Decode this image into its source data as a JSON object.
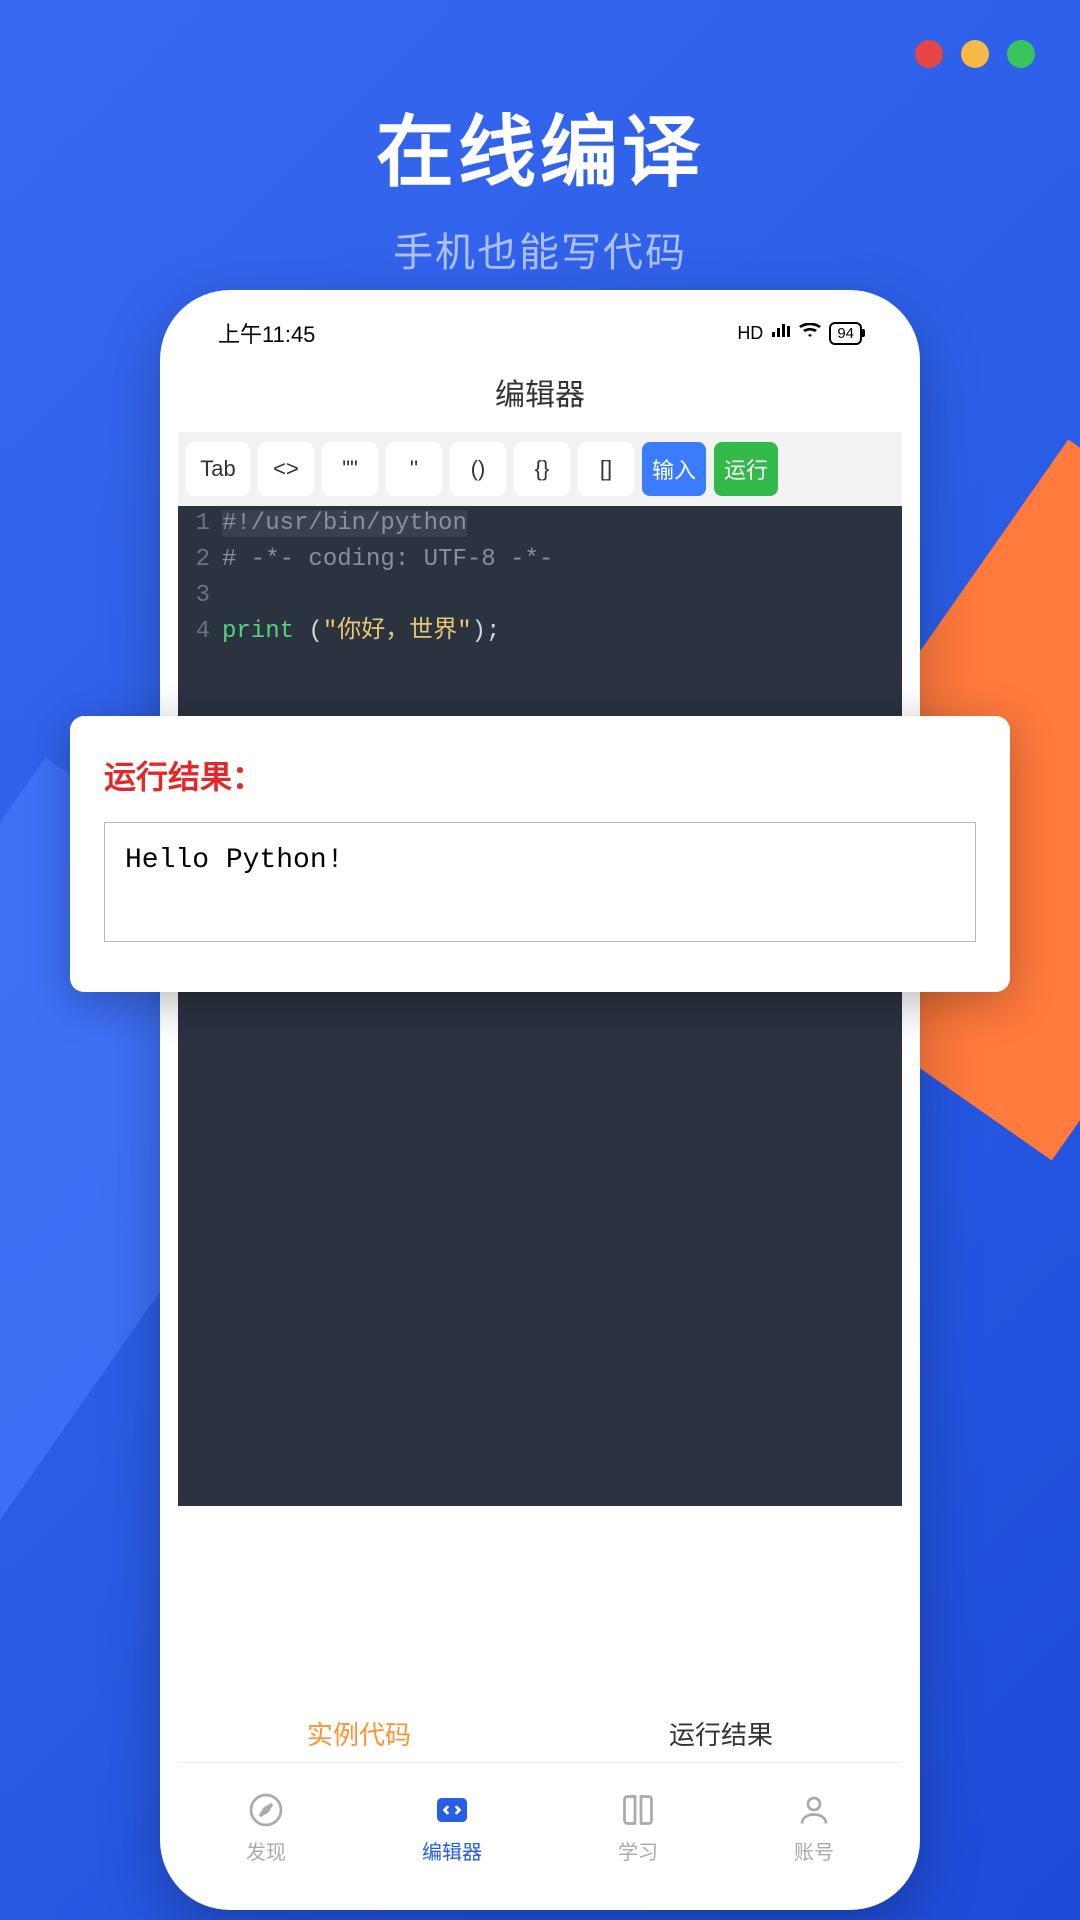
{
  "traffic": {
    "colors": [
      "#e84545",
      "#f5b945",
      "#3bc45e"
    ]
  },
  "hero": {
    "title": "在线编译",
    "subtitle": "手机也能写代码"
  },
  "status": {
    "time": "上午11:45",
    "signal": "HD",
    "battery": "94"
  },
  "app_header": "编辑器",
  "toolbar": {
    "tab": "Tab",
    "angle": "<>",
    "dquote": "\"\"",
    "squote": "''",
    "paren": "()",
    "brace": "{}",
    "bracket": "[]",
    "input": "输入",
    "run": "运行"
  },
  "code": {
    "lines": [
      {
        "no": "1",
        "type": "shebang",
        "text": "#!/usr/bin/python"
      },
      {
        "no": "2",
        "type": "comment",
        "text": "# -*- coding: UTF-8 -*-"
      },
      {
        "no": "3",
        "type": "blank",
        "text": ""
      },
      {
        "no": "4",
        "type": "print",
        "kw": "print",
        "sp": " ",
        "op": "(",
        "str": "\"你好，世界\"",
        "cp": ")",
        "semi": ";"
      }
    ]
  },
  "result": {
    "title": "运行结果：",
    "output": "Hello Python!"
  },
  "tab_row": {
    "left": "实例代码",
    "right": "运行结果"
  },
  "nav": {
    "discover": "发现",
    "editor": "编辑器",
    "learn": "学习",
    "account": "账号"
  }
}
